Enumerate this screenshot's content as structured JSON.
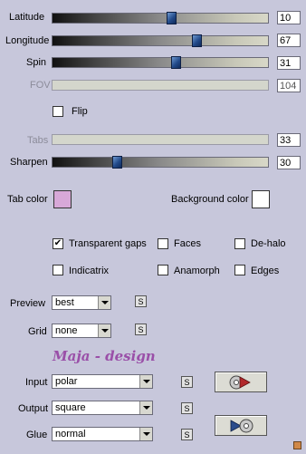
{
  "sliders": [
    {
      "label": "Latitude",
      "value": "10",
      "fraction": 0.55,
      "disabled": false
    },
    {
      "label": "Longitude",
      "value": "67",
      "fraction": 0.67,
      "disabled": false
    },
    {
      "label": "Spin",
      "value": "31",
      "fraction": 0.57,
      "disabled": false
    },
    {
      "label": "FOV",
      "value": "104",
      "fraction": null,
      "disabled": true
    }
  ],
  "flip": {
    "label": "Flip",
    "checked": false
  },
  "sliders2": [
    {
      "label": "Tabs",
      "value": "33",
      "fraction": null,
      "disabled": true
    },
    {
      "label": "Sharpen",
      "value": "30",
      "fraction": 0.3,
      "disabled": false
    }
  ],
  "colors": {
    "tab_label": "Tab color",
    "tab_swatch": "#d7a8d8",
    "bg_label": "Background color",
    "bg_swatch": "#ffffff"
  },
  "options": [
    {
      "label": "Transparent gaps",
      "checked": true
    },
    {
      "label": "Faces",
      "checked": false
    },
    {
      "label": "De-halo",
      "checked": false
    },
    {
      "label": "Indicatrix",
      "checked": false
    },
    {
      "label": "Anamorph",
      "checked": false
    },
    {
      "label": "Edges",
      "checked": false
    }
  ],
  "preview": {
    "label": "Preview",
    "value": "best",
    "s": "S"
  },
  "grid": {
    "label": "Grid",
    "value": "none",
    "s": "S"
  },
  "brand": "Maja - design",
  "input": {
    "label": "Input",
    "value": "polar",
    "s": "S"
  },
  "output": {
    "label": "Output",
    "value": "square",
    "s": "S"
  },
  "glue": {
    "label": "Glue",
    "value": "normal",
    "s": "S"
  }
}
